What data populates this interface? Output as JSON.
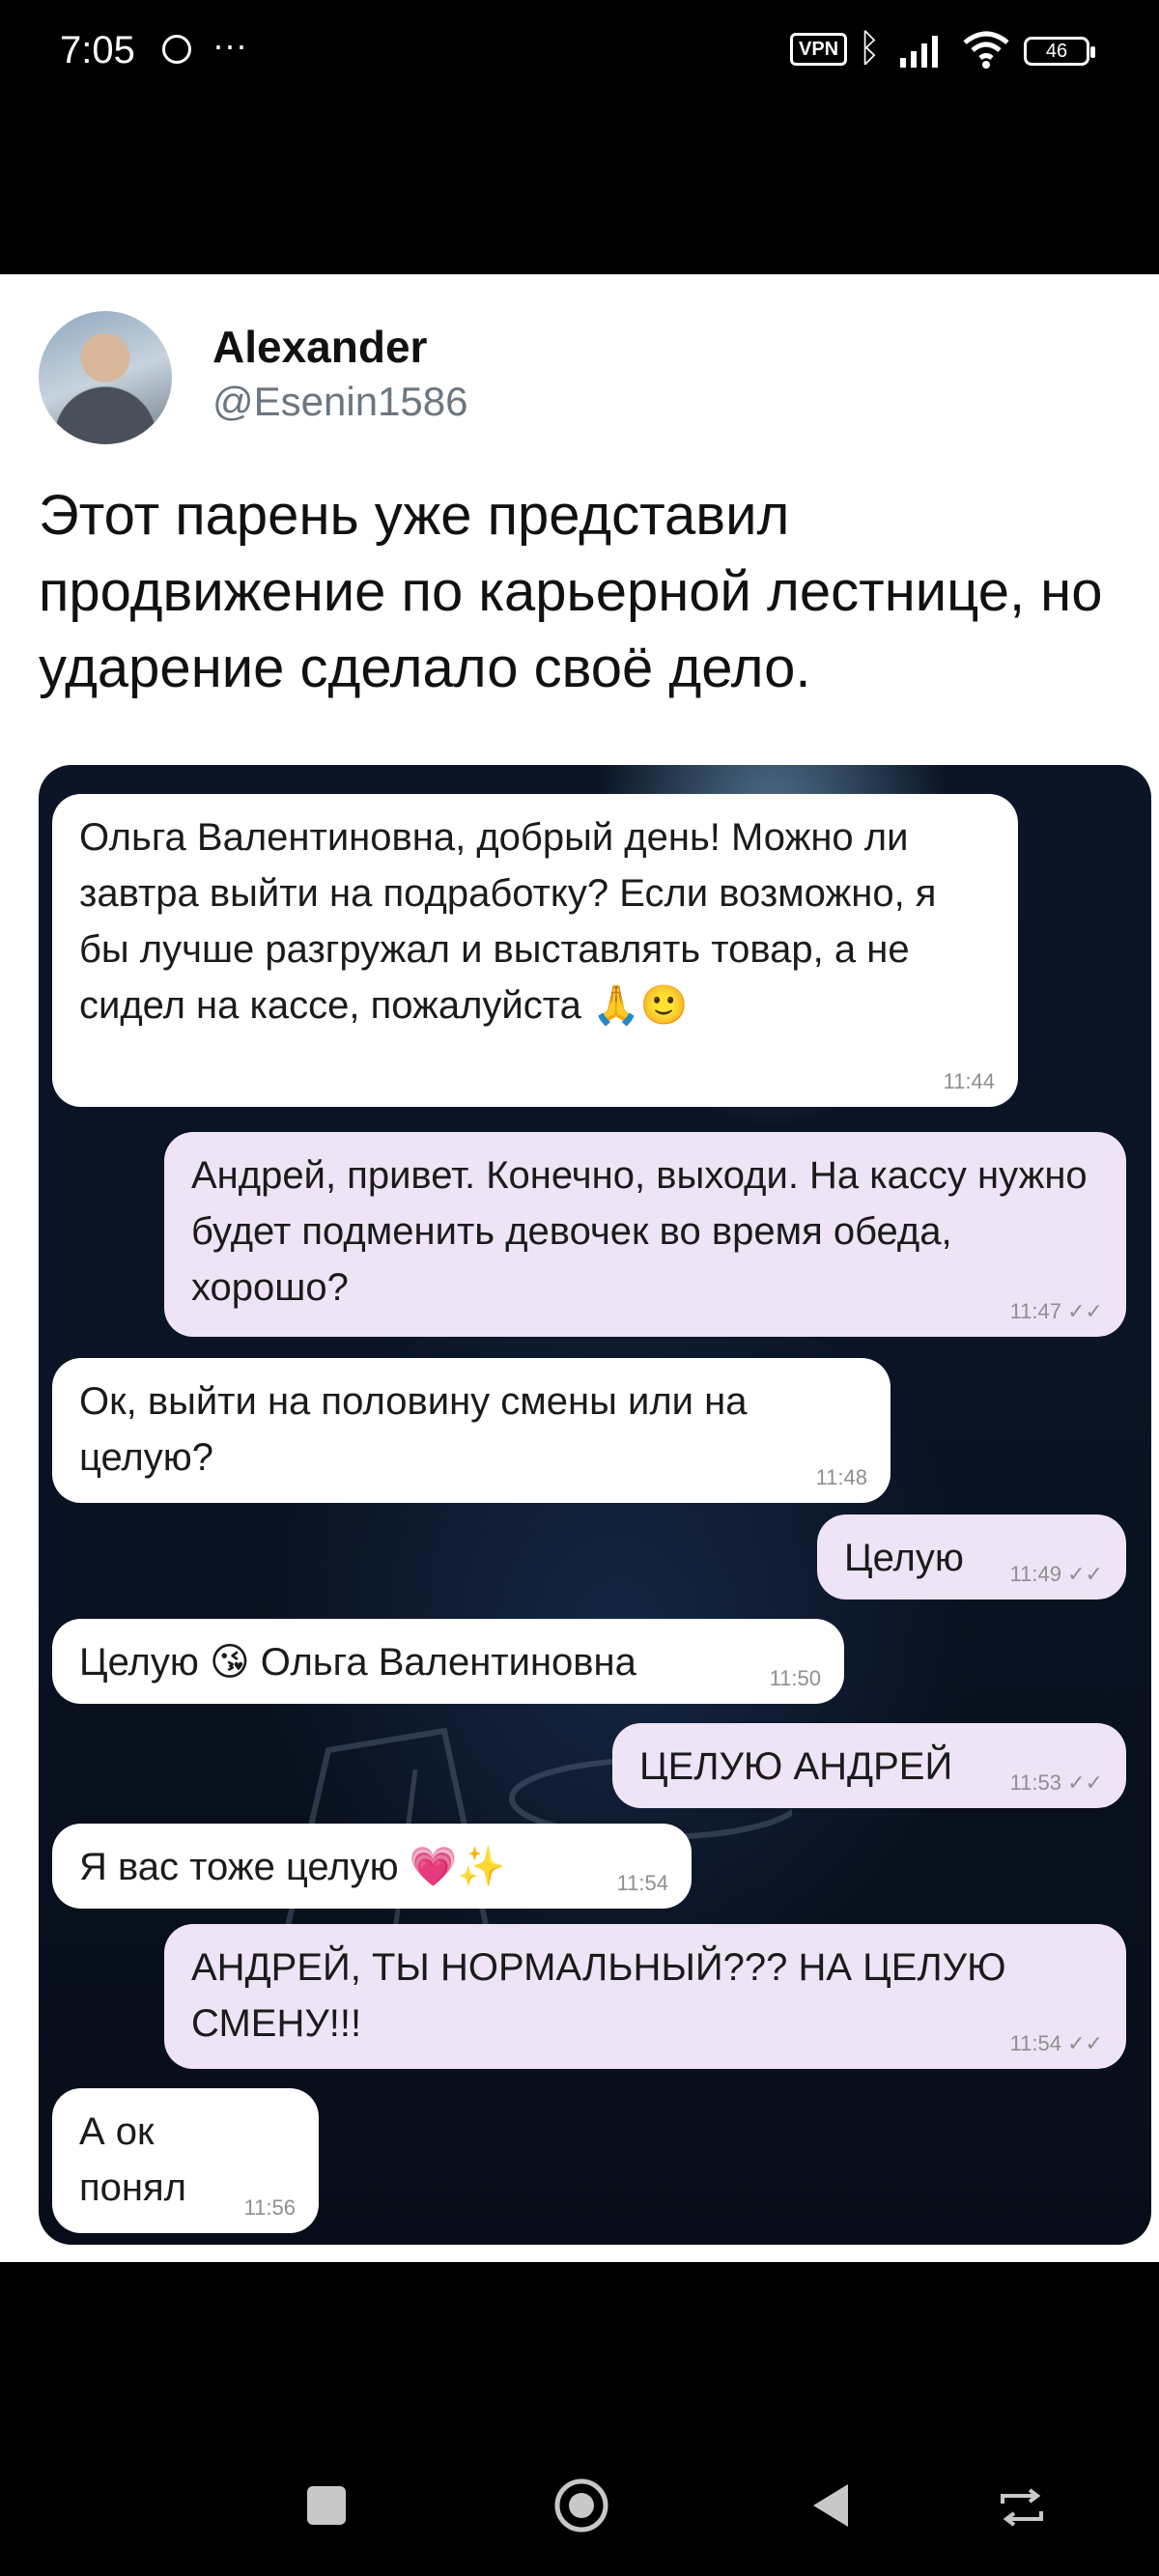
{
  "status_bar": {
    "time": "7:05",
    "dots": "···",
    "vpn": "VPN",
    "battery": "46"
  },
  "tweet": {
    "author_name": "Alexander",
    "author_handle": "@Esenin1586",
    "text": "Этот парень уже представил продвижение по карьерной лестнице, но ударение сделало своё дело."
  },
  "chat": {
    "messages": [
      {
        "side": "in",
        "text": "Ольга Валентиновна, добрый день! Можно ли завтра выйти на подработку? Если возможно, я бы лучше разгружал и выставлять товар, а не сидел на кассе, пожалуйста 🙏🙂",
        "time": "11:44"
      },
      {
        "side": "out",
        "text": "Андрей, привет. Конечно, выходи. На кассу нужно будет подменить девочек во время обеда, хорошо?",
        "time": "11:47"
      },
      {
        "side": "in",
        "text": "Ок, выйти на половину смены или на целую?",
        "time": "11:48"
      },
      {
        "side": "out",
        "text": "Целую",
        "time": "11:49"
      },
      {
        "side": "in",
        "text": "Целую 😘 Ольга Валентиновна",
        "time": "11:50"
      },
      {
        "side": "out",
        "text": "ЦЕЛУЮ АНДРЕЙ",
        "time": "11:53"
      },
      {
        "side": "in",
        "text": "Я вас тоже целую 💗✨",
        "time": "11:54"
      },
      {
        "side": "out",
        "text": "АНДРЕЙ, ТЫ НОРМАЛЬНЫЙ??? НА ЦЕЛУЮ СМЕНУ!!!",
        "time": "11:54"
      },
      {
        "side": "in",
        "text": "А ок понял",
        "time": "11:56"
      }
    ],
    "read_ticks": "✓✓"
  },
  "navbar": {
    "buttons": [
      "recents-icon",
      "home-icon",
      "back-icon",
      "switch-icon"
    ]
  }
}
